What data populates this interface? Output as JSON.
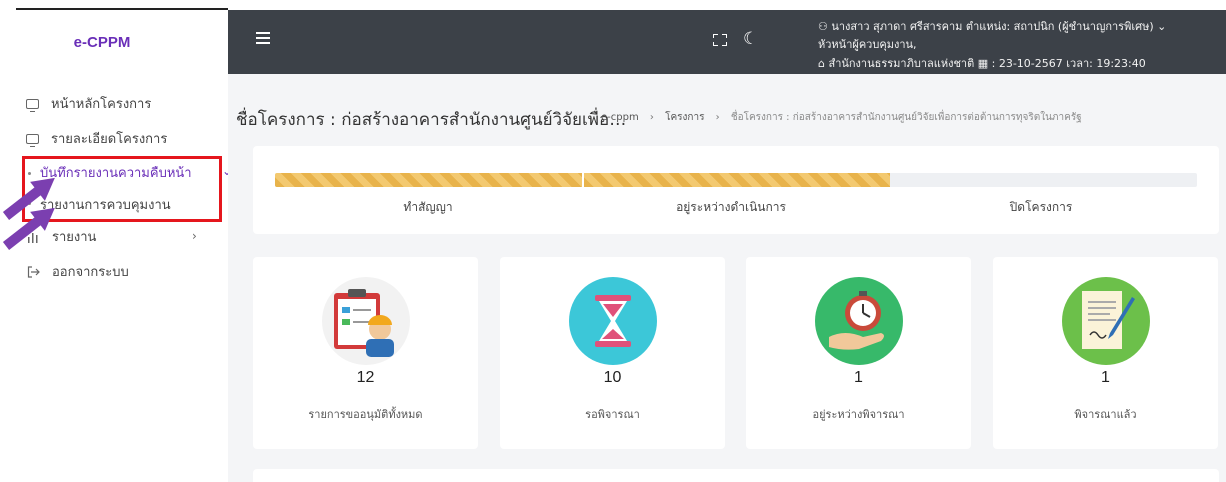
{
  "app": {
    "brand": "e-CPPM"
  },
  "sidebar": {
    "items": [
      {
        "label": "หน้าหลักโครงการ",
        "icon": "monitor-icon"
      },
      {
        "label": "รายละเอียดโครงการ",
        "icon": "monitor-icon"
      },
      {
        "label": "บันทึกรายงานความคืบหน้า",
        "icon": "dash-icon",
        "active": true
      },
      {
        "label": "รายงานการควบคุมงาน",
        "icon": "dash-icon"
      },
      {
        "label": "รายงาน",
        "icon": "bar-chart-icon",
        "chevron": "›"
      },
      {
        "label": "ออกจากระบบ",
        "icon": "logout-icon"
      }
    ],
    "highlight_color": "#e5161d",
    "arrow_color": "#7b3fb0"
  },
  "topbar": {
    "user_line": "นางสาว สุภาดา ศรีสารคาม ตำแหน่ง: สถาปนิก (ผู้ชำนาญการพิเศษ)",
    "role_line": "หัวหน้าผู้ควบคุมงาน,",
    "org_line": "สำนักงานธรรมาภิบาลแห่งชาติ",
    "date_line": ": 23-10-2567 เวลา: 19:23:40",
    "bg_color": "#3c4148"
  },
  "page": {
    "title": "ชื่อโครงการ : ก่อสร้างอาคารสำนักงานศูนย์วิจัยเพื่อ…",
    "breadcrumb": {
      "root": "e-cppm",
      "section": "โครงการ",
      "current": "ชื่อโครงการ : ก่อสร้างอาคารสำนักงานศูนย์วิจัยเพื่อการต่อต้านการทุจริตในภาครัฐ"
    }
  },
  "progress": {
    "steps": [
      {
        "label": "ทำสัญญา",
        "complete": 1.0
      },
      {
        "label": "อยู่ระหว่างดำเนินการ",
        "complete": 1.0
      },
      {
        "label": "ปิดโครงการ",
        "complete": 0.0
      }
    ],
    "fill_color": "#e8b34b"
  },
  "stats": [
    {
      "value": "12",
      "label": "รายการขออนุมัติทั้งหมด",
      "icon": "clipboard-worker-icon",
      "bg": "#f2f2f2"
    },
    {
      "value": "10",
      "label": "รอพิจารณา",
      "icon": "hourglass-icon",
      "bg": "#3cc7d8"
    },
    {
      "value": "1",
      "label": "อยู่ระหว่างพิจารณา",
      "icon": "stopwatch-hand-icon",
      "bg": "#37b96a"
    },
    {
      "value": "1",
      "label": "พิจารณาแล้ว",
      "icon": "signed-document-icon",
      "bg": "#6cc04a"
    }
  ]
}
